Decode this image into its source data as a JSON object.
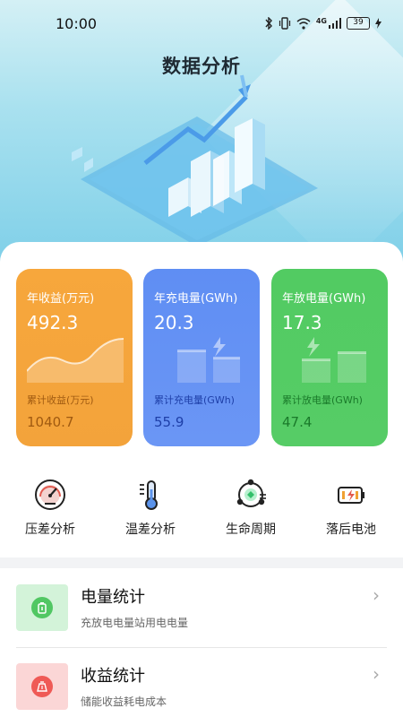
{
  "status_bar": {
    "time": "10:00",
    "network": "4G",
    "battery": "39",
    "icons": [
      "bluetooth-icon",
      "vibrate-icon",
      "wifi-icon",
      "cellular-signal-icon",
      "battery-icon",
      "charging-icon"
    ]
  },
  "page": {
    "title": "数据分析"
  },
  "stats": [
    {
      "label": "年收益(万元)",
      "value": "492.3",
      "sub_label": "累计收益(万元)",
      "sub_value": "1040.7",
      "color": "#f3a33b"
    },
    {
      "label": "年充电量(GWh)",
      "value": "20.3",
      "sub_label": "累计充电量(GWh)",
      "sub_value": "55.9",
      "color": "#6a95f5"
    },
    {
      "label": "年放电量(GWh)",
      "value": "17.3",
      "sub_label": "累计放电量(GWh)",
      "sub_value": "47.4",
      "color": "#55cc65"
    }
  ],
  "quick_actions": [
    {
      "label": "压差分析",
      "icon": "pressure-gauge-icon"
    },
    {
      "label": "温差分析",
      "icon": "thermometer-icon"
    },
    {
      "label": "生命周期",
      "icon": "life-cycle-icon"
    },
    {
      "label": "落后电池",
      "icon": "battery-warning-icon"
    }
  ],
  "list": [
    {
      "title": "电量统计",
      "desc": "充放电电量站用电电量",
      "icon": "battery-stats-icon",
      "color": "#51c763"
    },
    {
      "title": "收益统计",
      "desc": "储能收益耗电成本",
      "icon": "revenue-stats-icon",
      "color": "#ef5a56"
    }
  ]
}
